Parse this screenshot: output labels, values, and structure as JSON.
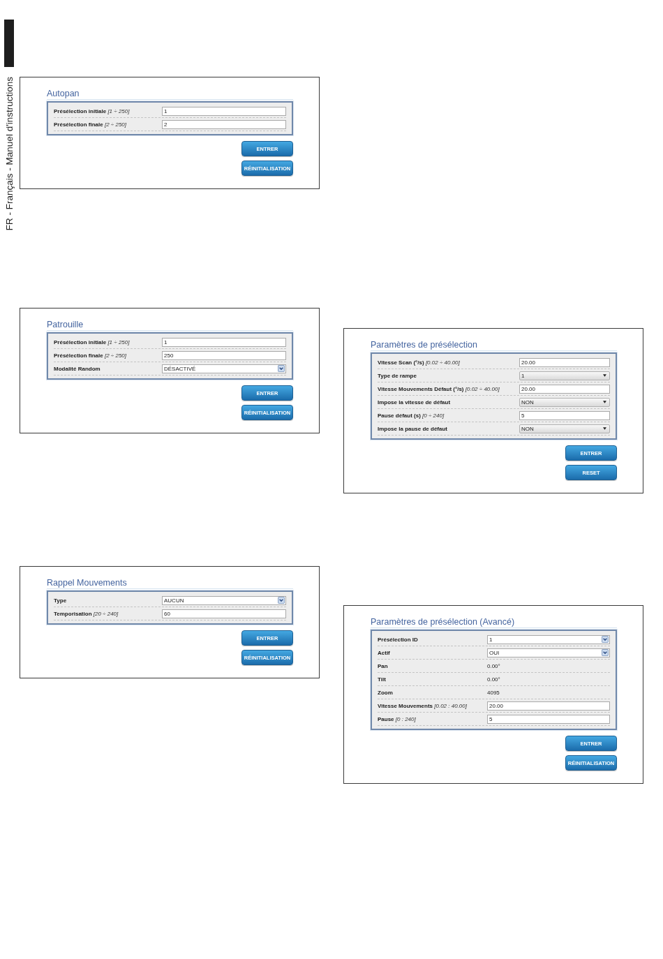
{
  "side_tab": {
    "text": "FR - Français - Manuel d'instructions"
  },
  "left_panels": [
    {
      "title": "Autopan",
      "rows": [
        {
          "label": "Présélection initiale",
          "range": "[1 ÷ 250]",
          "kind": "text",
          "value": "1"
        },
        {
          "label": "Présélection finale",
          "range": "[2 ÷ 250]",
          "kind": "text",
          "value": "2"
        }
      ],
      "buttons": [
        "ENTRER",
        "RÉINITIALISATION"
      ]
    },
    {
      "title": "Patrouille",
      "rows": [
        {
          "label": "Présélection initiale",
          "range": "[1 ÷ 250]",
          "kind": "text",
          "value": "1"
        },
        {
          "label": "Présélection finale",
          "range": "[2 ÷ 250]",
          "kind": "text",
          "value": "250"
        },
        {
          "label": "Modalité Random",
          "kind": "select",
          "value": "DÉSACTIVÉ"
        }
      ],
      "buttons": [
        "ENTRER",
        "RÉINITIALISATION"
      ]
    },
    {
      "title": "Rappel Mouvements",
      "rows": [
        {
          "label": "Type",
          "kind": "select",
          "value": "AUCUN"
        },
        {
          "label": "Temporisation",
          "range": "[20 ÷ 240]",
          "kind": "text",
          "value": "60"
        }
      ],
      "buttons": [
        "ENTRER",
        "RÉINITIALISATION"
      ]
    }
  ],
  "right_panels": [
    {
      "title": "Paramètres de présélection",
      "rows": [
        {
          "label": "Vitesse Scan (°/s)",
          "range": "[0.02 ÷ 40.00]",
          "kind": "text",
          "value": "20.00"
        },
        {
          "label": "Type de rampe",
          "kind": "dropdown",
          "value": "1"
        },
        {
          "label": "Vitesse Mouvements Défaut (°/s)",
          "range": "[0.02 ÷ 40.00]",
          "kind": "text",
          "value": "20.00"
        },
        {
          "label": "Impose la vitesse de défaut",
          "kind": "dropdown",
          "value": "NON"
        },
        {
          "label": "Pause défaut (s)",
          "range": "[0 ÷ 240]",
          "kind": "text",
          "value": "5"
        },
        {
          "label": "Impose la pause de défaut",
          "kind": "dropdown",
          "value": "NON"
        }
      ],
      "buttons": [
        "ENTRER",
        "RESET"
      ]
    },
    {
      "title": "Paramètres de présélection (Avancé)",
      "rows": [
        {
          "label": "Présélection ID",
          "kind": "select",
          "value": "1"
        },
        {
          "label": "Actif",
          "kind": "select",
          "value": "OUI"
        },
        {
          "label": "Pan",
          "kind": "static",
          "value": "0.00°"
        },
        {
          "label": "Tilt",
          "kind": "static",
          "value": "0.00°"
        },
        {
          "label": "Zoom",
          "kind": "static",
          "value": "4095"
        },
        {
          "label": "Vitesse Mouvements",
          "range": "[0.02 : 40.00]",
          "kind": "text",
          "value": "20.00"
        },
        {
          "label": "Pause",
          "range": "[0 : 240]",
          "kind": "text",
          "value": "5"
        }
      ],
      "buttons": [
        "ENTRER",
        "RÉINITIALISATION"
      ]
    }
  ]
}
